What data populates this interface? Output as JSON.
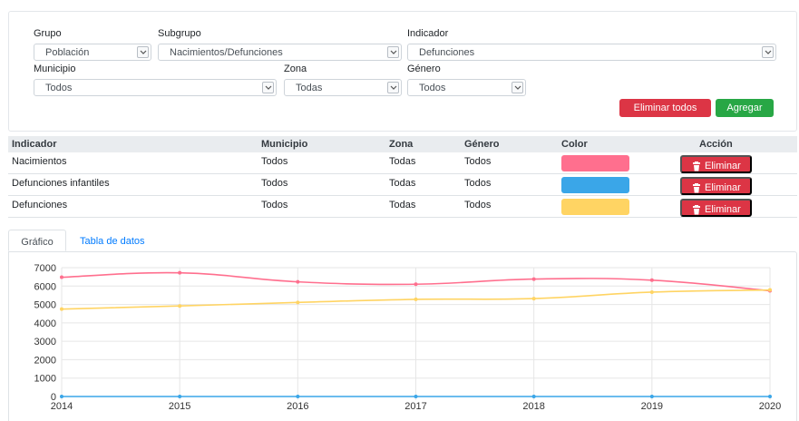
{
  "filters": {
    "grupo": {
      "label": "Grupo",
      "value": "Población"
    },
    "subgrupo": {
      "label": "Subgrupo",
      "value": "Nacimientos/Defunciones"
    },
    "indicador": {
      "label": "Indicador",
      "value": "Defunciones"
    },
    "municipio": {
      "label": "Municipio",
      "value": "Todos"
    },
    "zona": {
      "label": "Zona",
      "value": "Todas"
    },
    "genero": {
      "label": "Género",
      "value": "Todos"
    }
  },
  "actions": {
    "remove_all": "Eliminar todos",
    "add": "Agregar"
  },
  "table": {
    "headers": {
      "indicador": "Indicador",
      "municipio": "Municipio",
      "zona": "Zona",
      "genero": "Género",
      "color": "Color",
      "accion": "Acción"
    },
    "rows": [
      {
        "indicador": "Nacimientos",
        "municipio": "Todos",
        "zona": "Todas",
        "genero": "Todos",
        "color": "#ff6f8e",
        "action": "Eliminar"
      },
      {
        "indicador": "Defunciones infantiles",
        "municipio": "Todos",
        "zona": "Todas",
        "genero": "Todos",
        "color": "#3aa6e8",
        "action": "Eliminar"
      },
      {
        "indicador": "Defunciones",
        "municipio": "Todos",
        "zona": "Todas",
        "genero": "Todos",
        "color": "#ffd463",
        "action": "Eliminar"
      }
    ]
  },
  "tabs": {
    "chart": "Gráfico",
    "data": "Tabla de datos"
  },
  "chart_data": {
    "type": "line",
    "x": [
      "2014",
      "2015",
      "2016",
      "2017",
      "2018",
      "2019",
      "2020"
    ],
    "ylim": [
      0,
      7000
    ],
    "yticks": [
      "0",
      "1000",
      "2000",
      "3000",
      "4000",
      "5000",
      "6000",
      "7000"
    ],
    "grid": true,
    "series": [
      {
        "color": "#ff6f8e",
        "values": [
          6480,
          6720,
          6230,
          6100,
          6380,
          6320,
          5740
        ]
      },
      {
        "color": "#ffd463",
        "values": [
          4750,
          4920,
          5110,
          5280,
          5320,
          5670,
          5790
        ]
      },
      {
        "color": "#3aa6e8",
        "values": [
          0,
          0,
          0,
          0,
          0,
          0,
          0
        ]
      }
    ]
  }
}
